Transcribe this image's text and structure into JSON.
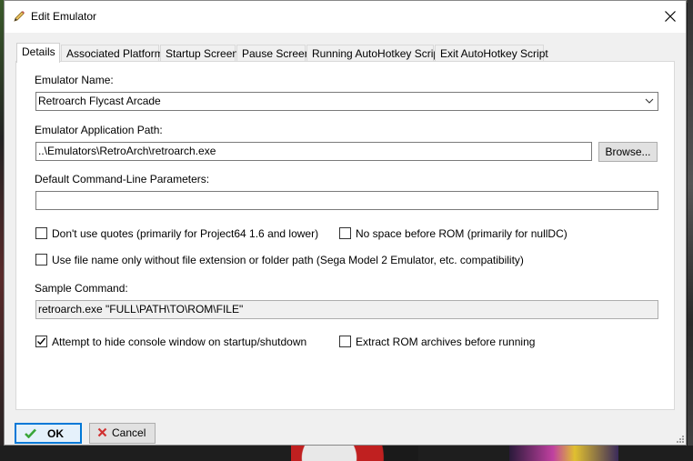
{
  "window": {
    "title": "Edit Emulator"
  },
  "tabs": [
    {
      "label": "Details",
      "active": true
    },
    {
      "label": "Associated Platforms",
      "active": false
    },
    {
      "label": "Startup Screen",
      "active": false
    },
    {
      "label": "Pause Screen",
      "active": false
    },
    {
      "label": "Running AutoHotkey Script",
      "active": false
    },
    {
      "label": "Exit AutoHotkey Script",
      "active": false
    }
  ],
  "details": {
    "name_label": "Emulator Name:",
    "name_value": "Retroarch Flycast Arcade",
    "path_label": "Emulator Application Path:",
    "path_value": "..\\Emulators\\RetroArch\\retroarch.exe",
    "browse_label": "Browse...",
    "params_label": "Default Command-Line Parameters:",
    "params_value": "",
    "options": [
      {
        "label": "Don't use quotes (primarily for Project64 1.6 and lower)",
        "checked": false
      },
      {
        "label": "No space before ROM (primarily for nullDC)",
        "checked": false
      },
      {
        "label": "Use file name only without file extension or folder path (Sega Model 2 Emulator, etc. compatibility)",
        "checked": false
      }
    ],
    "sample_label": "Sample Command:",
    "sample_value": "retroarch.exe \"FULL\\PATH\\TO\\ROM\\FILE\"",
    "hide_console": {
      "label": "Attempt to hide console window on startup/shutdown",
      "checked": true
    },
    "extract_rom": {
      "label": "Extract ROM archives before running",
      "checked": false
    }
  },
  "buttons": {
    "ok": "OK",
    "cancel": "Cancel"
  },
  "icons": {
    "title": "pencil-icon",
    "close": "close-icon",
    "ok": "green-checkmark-icon",
    "cancel": "red-x-icon",
    "combo": "chevron-down-icon"
  },
  "colors": {
    "accent": "#0078d7",
    "ok_icon": "#3aa63a",
    "cancel_icon": "#d03030"
  }
}
